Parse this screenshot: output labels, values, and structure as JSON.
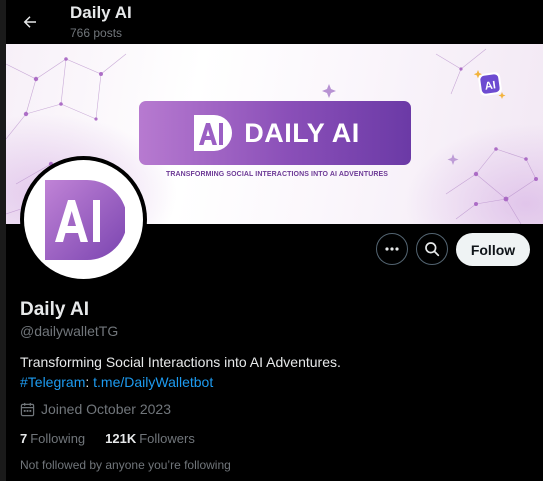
{
  "header": {
    "title": "Daily AI",
    "post_count": "766 posts"
  },
  "banner": {
    "logo_text": "DAILY AI",
    "logo_mark": "AI",
    "tagline": "TRANSFORMING SOCIAL INTERACTIONS INTO AI ADVENTURES",
    "badge_text": "AI",
    "background_color": "#f7f0f8",
    "accent_color": "#8a4fb8"
  },
  "avatar": {
    "mark": "AI"
  },
  "actions": {
    "more_icon": "ellipsis-icon",
    "search_icon": "search-icon",
    "follow_label": "Follow"
  },
  "profile": {
    "name": "Daily AI",
    "handle": "@dailywalletTG",
    "bio": "Transforming Social Interactions into AI Adventures.",
    "hashtag": "#Telegram",
    "link_separator": ": ",
    "link": "t.me/DailyWalletbot",
    "joined": "Joined October 2023",
    "following_count": "7",
    "following_label": "Following",
    "followers_count": "121K",
    "followers_label": "Followers",
    "not_followed_text": "Not followed by anyone you’re following"
  },
  "colors": {
    "background": "#000000",
    "text_primary": "#e7e9ea",
    "text_secondary": "#71767b",
    "link": "#1d9bf0",
    "follow_button": "#eff3f4"
  }
}
